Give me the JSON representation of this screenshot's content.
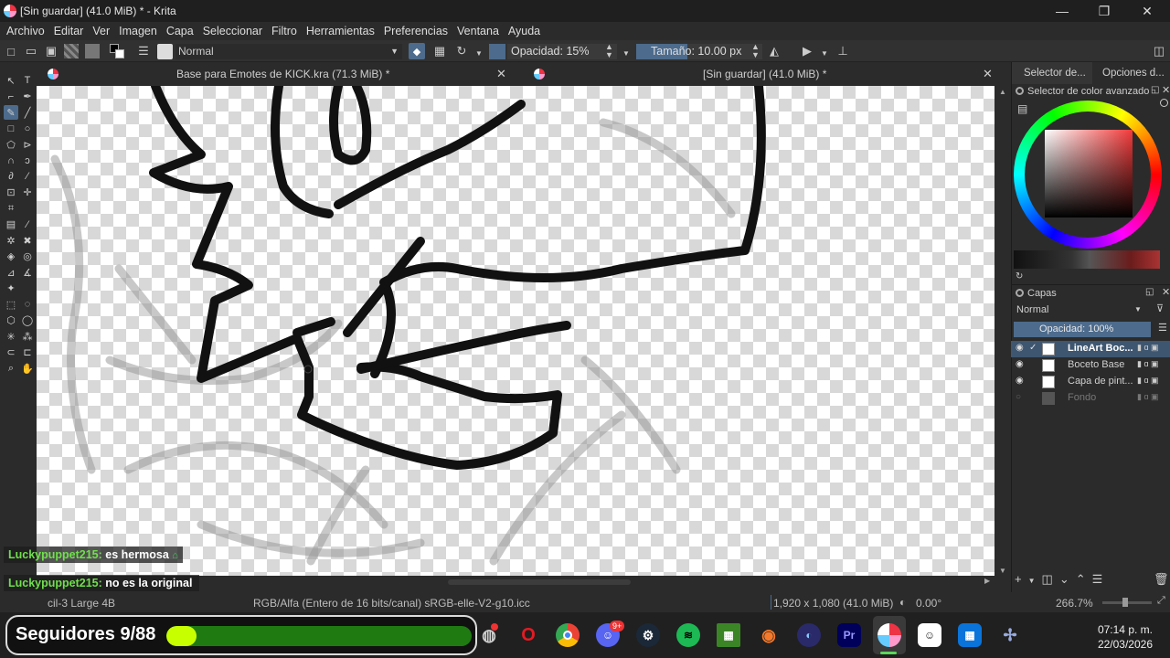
{
  "window": {
    "title": "[Sin guardar]  (41.0 MiB) * - Krita",
    "minimize": "—",
    "maximize": "❐",
    "close": "✕"
  },
  "menu": [
    "Archivo",
    "Editar",
    "Ver",
    "Imagen",
    "Capa",
    "Seleccionar",
    "Filtro",
    "Herramientas",
    "Preferencias",
    "Ventana",
    "Ayuda"
  ],
  "toolbar": {
    "blend_mode": "Normal",
    "opacity": "Opacidad: 15%",
    "size": "Tamaño: 10.00 px"
  },
  "tabs": [
    {
      "label": "Base para Emotes de KICK.kra (71.3 MiB) *",
      "close": "✕"
    },
    {
      "label": "[Sin guardar]  (41.0 MiB) *",
      "close": "✕"
    }
  ],
  "dock": {
    "tabs": [
      "Selector de...",
      "Opciones d..."
    ],
    "color_panel_title": "Selector de color avanzado",
    "layers_title": "Capas",
    "layer_blend": "Normal",
    "layer_opacity": "Opacidad:  100%",
    "layers": [
      {
        "name": "LineArt Boc..."
      },
      {
        "name": "Boceto Base"
      },
      {
        "name": "Capa de pint..."
      },
      {
        "name": "Fondo"
      }
    ]
  },
  "statusbar": {
    "brush": "cil-3 Large 4B",
    "colorspace": "RGB/Alfa (Entero de 16 bits/canal)  sRGB-elle-V2-g10.icc",
    "dimensions": "1,920 x 1,080 (41.0 MiB)",
    "rotation": "0.00°",
    "zoom": "266.7%"
  },
  "chat": [
    {
      "user": "Luckypuppet215:",
      "message": "es hermosa"
    },
    {
      "user": "Luckypuppet215:",
      "message": "no es la original"
    }
  ],
  "overlay": {
    "followers": "Seguidores 9/88",
    "progress": 0.1
  },
  "taskbar": {
    "time": "07:14 p. m.",
    "date": "22/03/2026",
    "discord_badge": "9+"
  },
  "colors": {
    "accent": "#4d6b8c",
    "progress": "#c8ff00"
  }
}
